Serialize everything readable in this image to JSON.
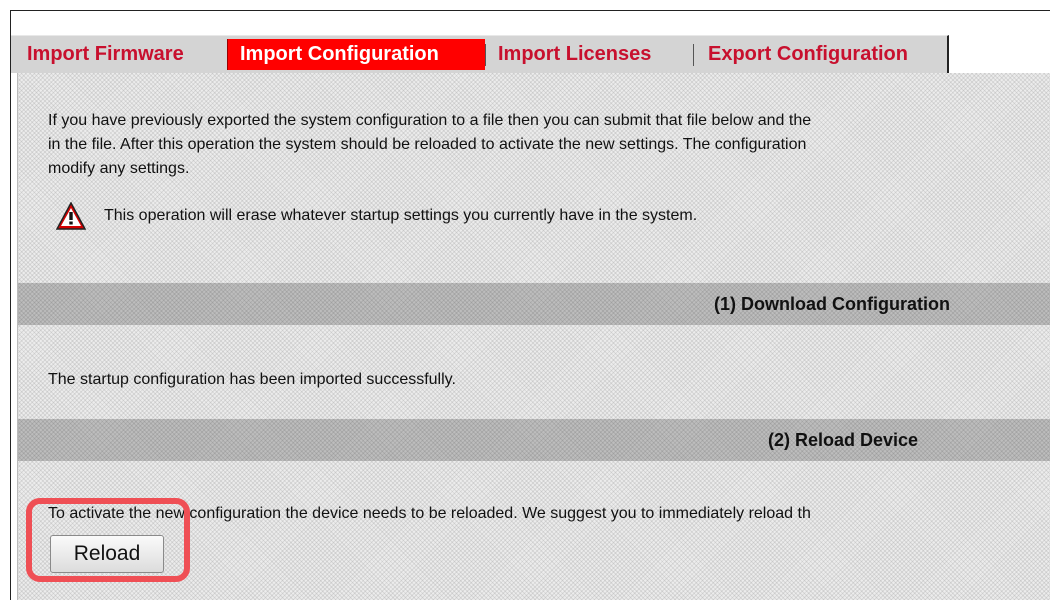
{
  "tabs": [
    {
      "label": "Import Firmware",
      "active": false
    },
    {
      "label": "Import Configuration",
      "active": true
    },
    {
      "label": "Import Licenses",
      "active": false
    },
    {
      "label": "Export Configuration",
      "active": false
    }
  ],
  "intro": {
    "lines": [
      "If you have previously exported the system configuration to a file then you can submit that file below and the",
      "in the file. After this operation the system should be reloaded to activate the new settings. The configuration",
      "modify any settings."
    ]
  },
  "warning": {
    "icon": "warning-triangle-icon",
    "text": "This operation will erase whatever startup settings you currently have in the system."
  },
  "sections": {
    "download": {
      "title": "(1) Download Configuration",
      "status": "The startup configuration has been imported successfully."
    },
    "reload": {
      "title": "(2) Reload Device",
      "text": "To activate the new configuration the device needs to be reloaded. We suggest you to immediately reload th",
      "button_label": "Reload"
    }
  },
  "colors": {
    "tab_text": "#c8102e",
    "tab_active_bg": "#ff0000",
    "highlight": "#ef4f55"
  }
}
